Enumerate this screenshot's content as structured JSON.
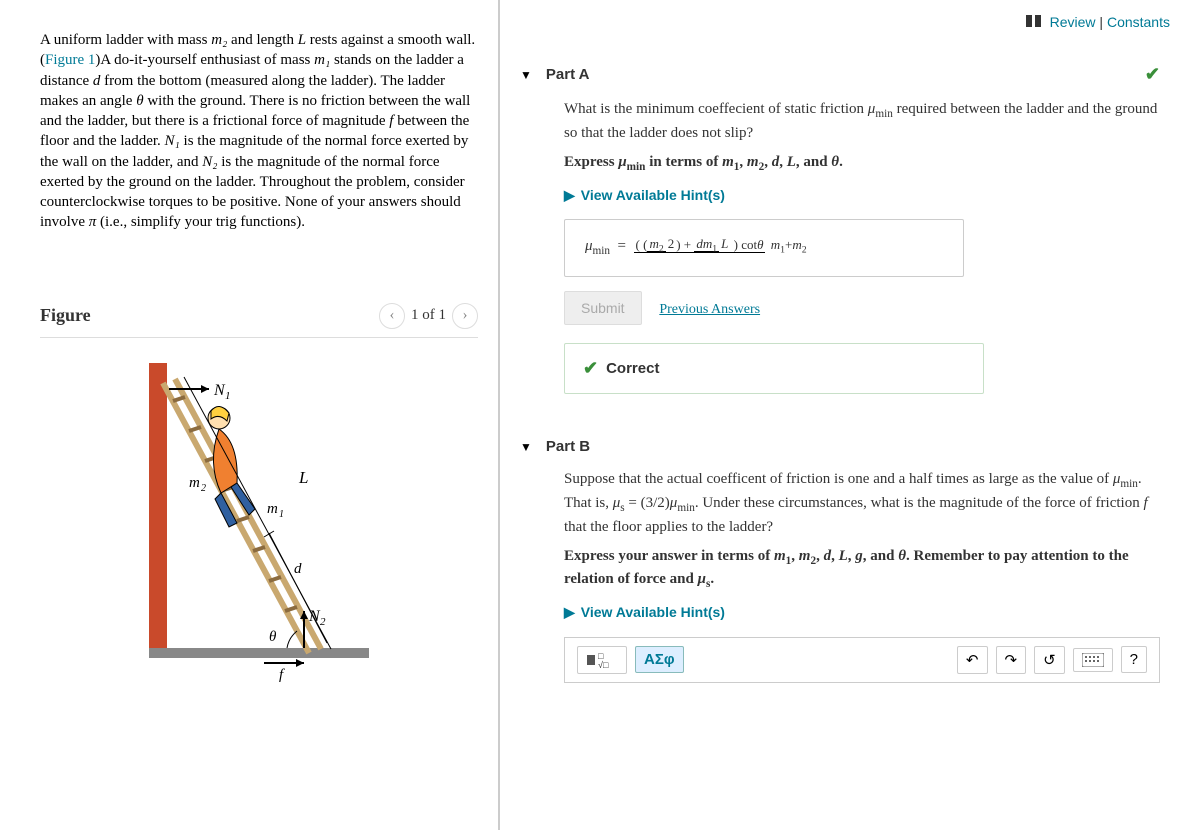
{
  "top": {
    "review": "Review",
    "constants": "Constants"
  },
  "problem": {
    "text_a": "A uniform ladder with mass ",
    "m2": "m₂",
    "text_b": " and length ",
    "L": "L",
    "text_c": " rests against a smooth wall. (",
    "fig_link": "Figure 1",
    "text_d": ")A do-it-yourself enthusiast of mass ",
    "m1": "m₁",
    "text_e": " stands on the ladder a distance ",
    "d": "d",
    "text_f": " from the bottom (measured along the ladder). The ladder makes an angle ",
    "theta": "θ",
    "text_g": " with the ground. There is no friction between the wall and the ladder, but there is a frictional force of magnitude ",
    "f": "f",
    "text_h": " between the floor and the ladder. ",
    "N1": "N₁",
    "text_i": " is the magnitude of the normal force exerted by the wall on the ladder, and ",
    "N2": "N₂",
    "text_j": " is the magnitude of the normal force exerted by the ground on the ladder. Throughout the problem, consider counterclockwise torques to be positive. None of your answers should involve ",
    "pi": "π",
    "text_k": " (i.e., simplify your trig functions)."
  },
  "figure": {
    "title": "Figure",
    "counter": "1 of 1",
    "labels": {
      "N1": "N₁",
      "N2": "N₂",
      "m1": "m₁",
      "m2": "m₂",
      "L": "L",
      "d": "d",
      "theta": "θ",
      "f": "f"
    }
  },
  "partA": {
    "title": "Part A",
    "question": "What is the minimum coeffecient of static friction μmin required between the ladder and the ground so that the ladder does not slip?",
    "express": "Express μmin in terms of m₁, m₂, d, L, and θ.",
    "hints": "View Available Hint(s)",
    "answer_label": "μmin =",
    "submit": "Submit",
    "previous": "Previous Answers",
    "correct": "Correct"
  },
  "partB": {
    "title": "Part B",
    "question": "Suppose that the actual coefficent of friction is one and a half times as large as the value of μmin. That is, μs = (3/2)μmin. Under these circumstances, what is the magnitude of the force of friction f that the floor applies to the ladder?",
    "express": "Express your answer in terms of m₁, m₂, d, L, g, and θ. Remember to pay attention to the relation of force and μs.",
    "hints": "View Available Hint(s)"
  },
  "toolbar": {
    "greek": "ΑΣφ",
    "help": "?"
  }
}
